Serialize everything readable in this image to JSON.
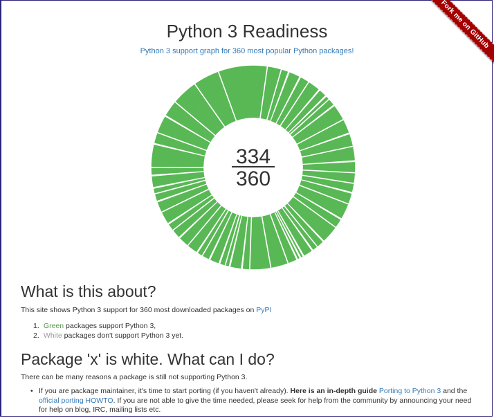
{
  "ribbon": {
    "label": "Fork me on GitHub"
  },
  "header": {
    "title": "Python 3 Readiness",
    "subtitle": "Python 3 support graph for 360 most popular Python packages!"
  },
  "colors": {
    "supported": "#58b854",
    "unsupported": "#ffffff",
    "link": "#337ab7"
  },
  "counter": {
    "supported": "334",
    "total": "360"
  },
  "chart_data": {
    "type": "pie",
    "title": "",
    "total": 360,
    "supported": 334,
    "unsupported": 26,
    "series": [
      {
        "name": "Green",
        "value": 334
      },
      {
        "name": "White",
        "value": 26
      }
    ]
  },
  "about": {
    "heading": "What is this about?",
    "intro": "This site shows Python 3 support for 360 most downloaded packages on",
    "pypi_link": "PyPI",
    "items": [
      {
        "num": "1.",
        "colored": "Green",
        "rest": " packages support Python 3,"
      },
      {
        "num": "2.",
        "colored": "White",
        "rest": " packages don't support Python 3 yet."
      }
    ]
  },
  "faq": {
    "heading": "Package 'x' is white. What can I do?",
    "intro": "There can be many reasons a package is still not supporting Python 3.",
    "bullet": {
      "part1": "If you are package maintainer, it's time to start porting (if you haven't already).",
      "bold": "Here is an in-depth guide",
      "link1": "Porting to Python 3",
      "part2": "and the",
      "link2": "official porting HOWTO",
      "part3": ". If you are not able to give the time needed, please seek for help from the community by announcing your need for help on blog, IRC, mailing lists etc."
    }
  }
}
